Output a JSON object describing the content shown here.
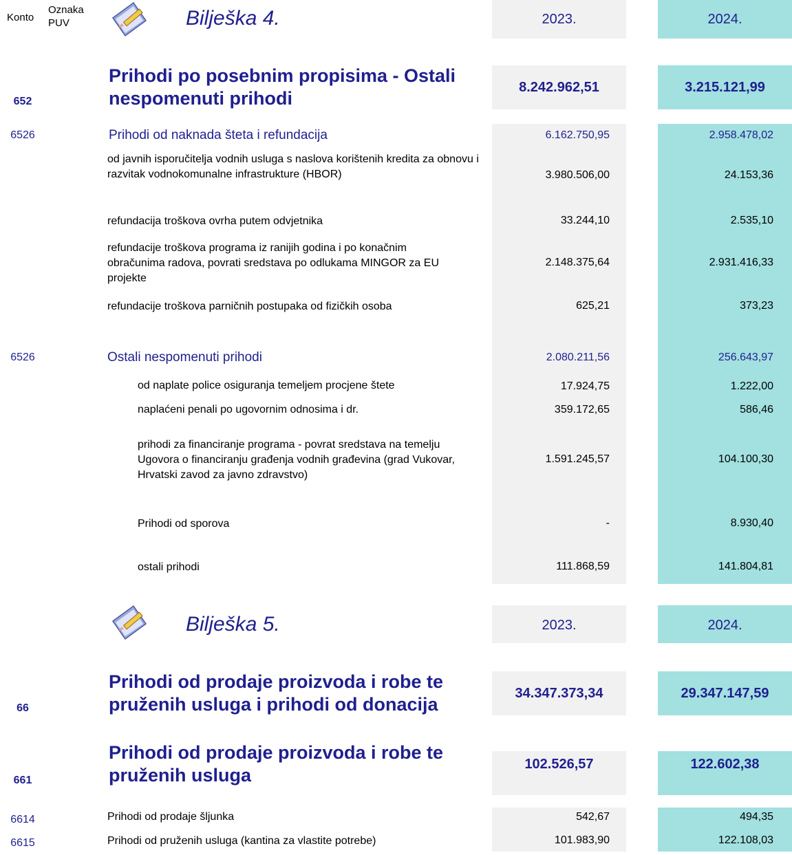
{
  "header": {
    "konto": "Konto",
    "oznaka": "Oznaka",
    "puv": "PUV"
  },
  "b4": {
    "title": "Bilješka 4.",
    "y2023": "2023.",
    "y2024": "2024.",
    "main": {
      "konto": "652",
      "label": "Prihodi po posebnim propisima - Ostali nespomenuti prihodi",
      "v2023": "8.242.962,51",
      "v2024": "3.215.121,99"
    },
    "sec1": {
      "konto": "6526",
      "label": "Prihodi od naknada šteta i refundacija",
      "v2023": "6.162.750,95",
      "v2024": "2.958.478,02"
    },
    "sec1_rows": [
      {
        "label": "od javnih isporučitelja vodnih usluga s naslova korištenih kredita za obnovu i razvitak vodnokomunalne infrastrukture (HBOR)",
        "v2023": "3.980.506,00",
        "v2024": "24.153,36"
      },
      {
        "label": "refundacija troškova ovrha putem odvjetnika",
        "v2023": "33.244,10",
        "v2024": "2.535,10"
      },
      {
        "label": "refundacije troškova programa iz ranijih godina i po konačnim obračunima radova, povrati sredstava po odlukama MINGOR za EU projekte",
        "v2023": "2.148.375,64",
        "v2024": "2.931.416,33"
      },
      {
        "label": "refundacije troškova parničnih postupaka od fizičkih osoba",
        "v2023": "625,21",
        "v2024": "373,23"
      }
    ],
    "sec2": {
      "konto": "6526",
      "label": "Ostali nespomenuti prihodi",
      "v2023": "2.080.211,56",
      "v2024": "256.643,97"
    },
    "sec2_rows": [
      {
        "label": "od naplate police osiguranja temeljem procjene štete",
        "v2023": "17.924,75",
        "v2024": "1.222,00"
      },
      {
        "label": "naplaćeni penali po ugovornim odnosima i dr.",
        "v2023": "359.172,65",
        "v2024": "586,46"
      },
      {
        "label": "prihodi za financiranje programa - povrat sredstava na temelju Ugovora o financiranju građenja vodnih građevina (grad Vukovar, Hrvatski zavod za javno zdravstvo)",
        "v2023": "1.591.245,57",
        "v2024": "104.100,30"
      },
      {
        "label": "Prihodi od sporova",
        "v2023": "-",
        "v2024": "8.930,40"
      },
      {
        "label": "ostali prihodi",
        "v2023": "111.868,59",
        "v2024": "141.804,81"
      }
    ]
  },
  "b5": {
    "title": "Bilješka 5.",
    "y2023": "2023.",
    "y2024": "2024.",
    "main": {
      "konto": "66",
      "label": "Prihodi od prodaje proizvoda i robe te pruženih usluga i prihodi od donacija",
      "v2023": "34.347.373,34",
      "v2024": "29.347.147,59"
    },
    "main2": {
      "konto": "661",
      "label": "Prihodi od prodaje proizvoda i robe te pruženih usluga",
      "v2023": "102.526,57",
      "v2024": "122.602,38"
    },
    "rows": [
      {
        "konto": "6614",
        "label": "Prihodi od prodaje šljunka",
        "v2023": "542,67",
        "v2024": "494,35"
      },
      {
        "konto": "6615",
        "label": "Prihodi od pruženih usluga (kantina za vlastite potrebe)",
        "v2023": "101.983,90",
        "v2024": "122.108,03"
      }
    ]
  }
}
